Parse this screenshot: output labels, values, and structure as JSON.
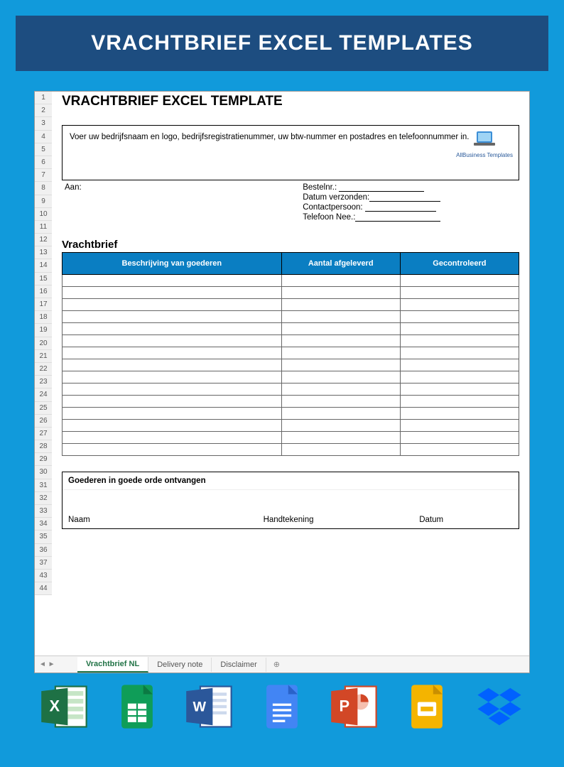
{
  "banner": {
    "title": "VRACHTBRIEF EXCEL TEMPLATES"
  },
  "doc": {
    "title": "VRACHTBRIEF EXCEL TEMPLATE",
    "info_text": "Voer uw bedrijfsnaam en logo, bedrijfsregistratienummer, uw btw-nummer en postadres en telefoonnummer in.",
    "logo_label": "AllBusiness Templates",
    "aan_label": "Aan:",
    "bestelnr_label": "Bestelnr.:",
    "datum_verzonden_label": "Datum verzonden:",
    "contactpersoon_label": "Contactpersoon:",
    "telefoon_label": "Telefoon Nee.:",
    "section_title": "Vrachtbrief",
    "columns": {
      "c1": "Beschrijving van goederen",
      "c2": "Aantal afgeleverd",
      "c3": "Gecontroleerd"
    },
    "receipt": {
      "title": "Goederen in goede orde ontvangen",
      "naam": "Naam",
      "handtekening": "Handtekening",
      "datum": "Datum"
    }
  },
  "row_numbers": [
    "1",
    "2",
    "3",
    "4",
    "5",
    "6",
    "7",
    "8",
    "9",
    "10",
    "11",
    "12",
    "13",
    "14",
    "15",
    "16",
    "17",
    "18",
    "19",
    "20",
    "21",
    "22",
    "23",
    "24",
    "25",
    "26",
    "27",
    "28",
    "29",
    "30",
    "31",
    "32",
    "33",
    "34",
    "35",
    "36",
    "37",
    "43",
    "44"
  ],
  "tabs": {
    "t1": "Vrachtbrief NL",
    "t2": "Delivery note",
    "t3": "Disclaimer",
    "add": "⊕"
  },
  "icons": {
    "excel": "excel-icon",
    "sheets": "sheets-icon",
    "word": "word-icon",
    "docs": "docs-icon",
    "ppt": "powerpoint-icon",
    "slides": "slides-icon",
    "dropbox": "dropbox-icon"
  }
}
